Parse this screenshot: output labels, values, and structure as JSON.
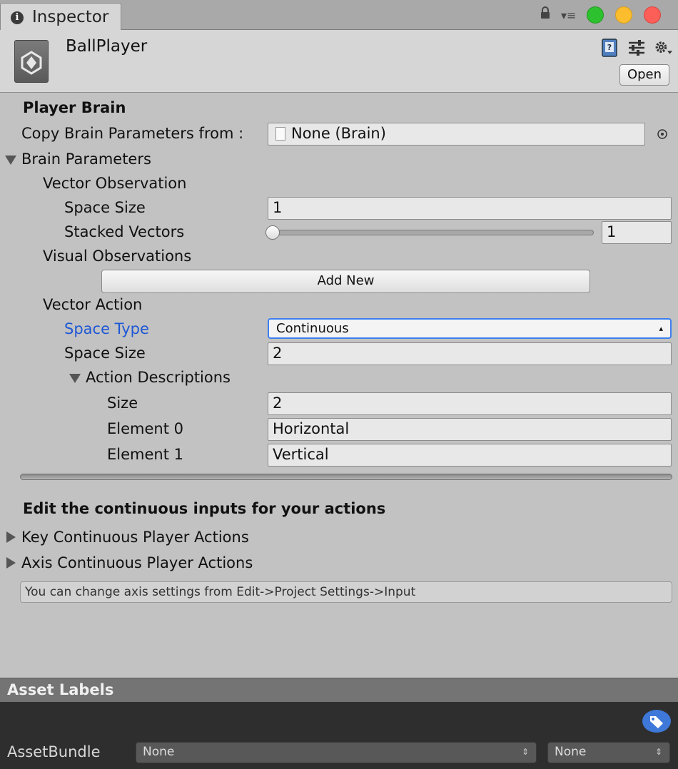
{
  "window": {
    "tab_label": "Inspector",
    "traffic_lights": [
      "#2ec12f",
      "#fbbd2e",
      "#fc5f57"
    ]
  },
  "header": {
    "object_name": "BallPlayer",
    "open_label": "Open",
    "icons": [
      "help-book-icon",
      "preset-sliders-icon",
      "gear-icon"
    ]
  },
  "brain": {
    "section_title": "Player Brain",
    "copy_label": "Copy Brain Parameters from :",
    "copy_value": "None (Brain)",
    "brain_parameters_label": "Brain Parameters",
    "vector_observation": {
      "label": "Vector Observation",
      "space_size_label": "Space Size",
      "space_size_value": "1",
      "stacked_label": "Stacked Vectors",
      "stacked_value": "1"
    },
    "visual_observations_label": "Visual Observations",
    "add_new_label": "Add New",
    "vector_action": {
      "label": "Vector Action",
      "space_type_label": "Space Type",
      "space_type_value": "Continuous",
      "space_size_label": "Space Size",
      "space_size_value": "2",
      "descriptions_label": "Action Descriptions",
      "size_label": "Size",
      "size_value": "2",
      "elements": [
        {
          "label": "Element 0",
          "value": "Horizontal"
        },
        {
          "label": "Element 1",
          "value": "Vertical"
        }
      ]
    }
  },
  "inputs": {
    "title": "Edit the continuous inputs for your actions",
    "key_actions_label": "Key Continuous Player Actions",
    "axis_actions_label": "Axis Continuous Player Actions",
    "help_text": "You can change axis settings from Edit->Project Settings->Input"
  },
  "asset_labels": {
    "title": "Asset Labels",
    "assetbundle_label": "AssetBundle",
    "bundle_value": "None",
    "variant_value": "None"
  },
  "colors": {
    "accent_blue": "#1f58d6",
    "focus_border": "#3d7ff0"
  }
}
